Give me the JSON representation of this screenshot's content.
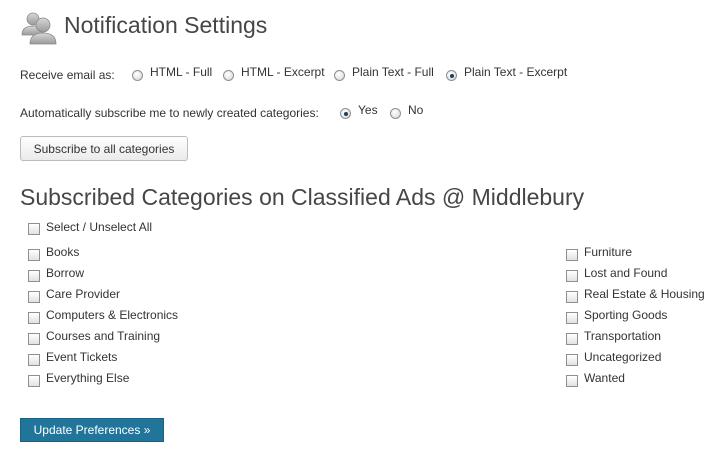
{
  "header": {
    "title": "Notification Settings",
    "icon": "users-icon"
  },
  "email": {
    "label": "Receive email as:",
    "options": [
      "HTML - Full",
      "HTML - Excerpt",
      "Plain Text - Full",
      "Plain Text - Excerpt"
    ],
    "selected": "Plain Text - Excerpt"
  },
  "auto_subscribe": {
    "label": "Automatically subscribe me to newly created categories:",
    "options": [
      "Yes",
      "No"
    ],
    "selected": "Yes"
  },
  "subscribe_all_button": "Subscribe to all categories",
  "categories": {
    "title": "Subscribed Categories on Classified Ads @ Middlebury",
    "select_all": "Select / Unselect All",
    "left": [
      "Books",
      "Borrow",
      "Care Provider",
      "Computers & Electronics",
      "Courses and Training",
      "Event Tickets",
      "Everything Else"
    ],
    "right": [
      "Furniture",
      "Lost and Found",
      "Real Estate & Housing",
      "Sporting Goods",
      "Transportation",
      "Uncategorized",
      "Wanted"
    ]
  },
  "update_button": "Update Preferences »",
  "colors": {
    "primary_button": "#21759b",
    "title_text": "#464646"
  }
}
